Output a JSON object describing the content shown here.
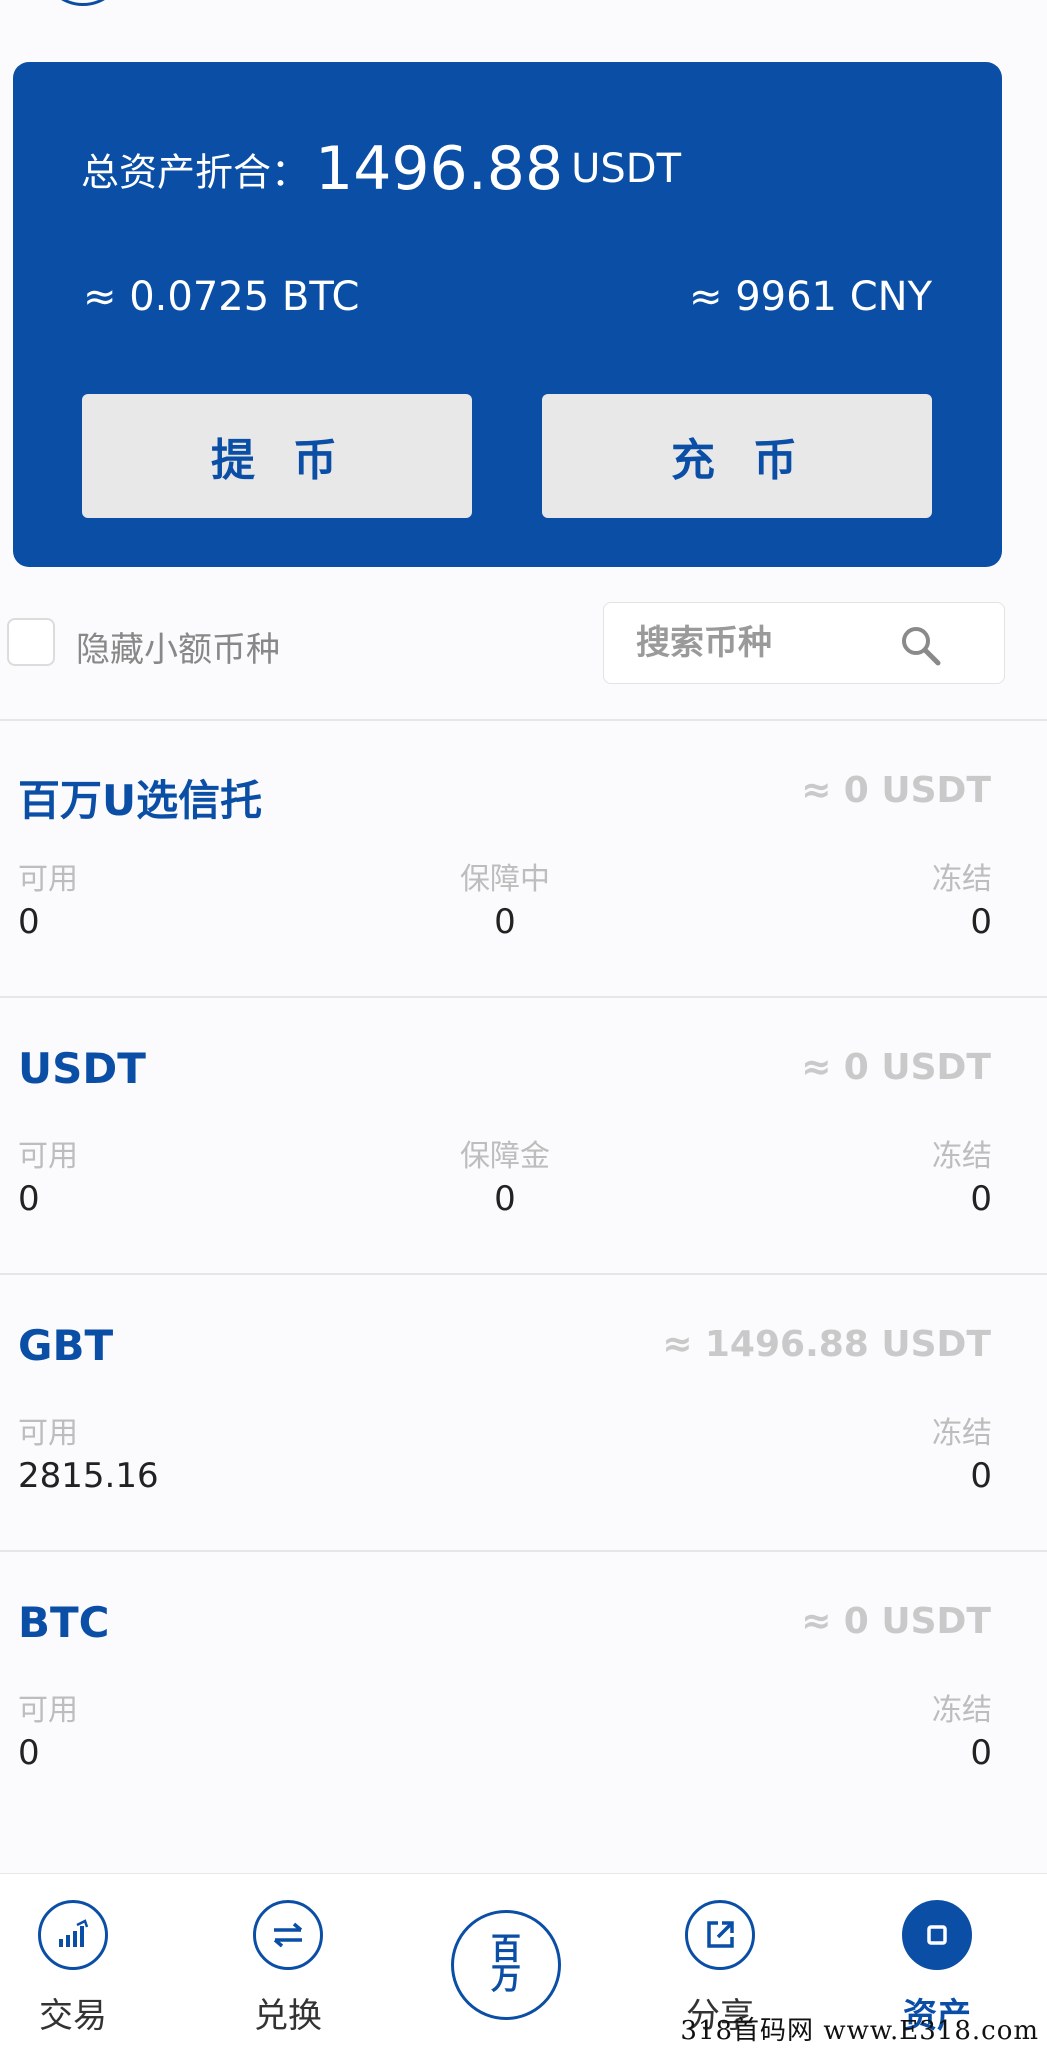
{
  "summary": {
    "total_label": "总资产折合：",
    "total_value": "1496.88",
    "total_unit": "USDT",
    "approx_btc": "≈ 0.0725 BTC",
    "approx_cny": "≈ 9961 CNY",
    "withdraw_label": "提币",
    "deposit_label": "充币"
  },
  "filter": {
    "hide_small_label": "隐藏小额币种",
    "search_placeholder": "搜索币种"
  },
  "coins": [
    {
      "name": "百万U选信托",
      "total": "≈ 0 USDT",
      "available_label": "可用",
      "available": "0",
      "mid_label": "保障中",
      "mid_value": "0",
      "frozen_label": "冻结",
      "frozen": "0"
    },
    {
      "name": "USDT",
      "total": "≈ 0 USDT",
      "available_label": "可用",
      "available": "0",
      "mid_label": "保障金",
      "mid_value": "0",
      "frozen_label": "冻结",
      "frozen": "0"
    },
    {
      "name": "GBT",
      "total": "≈ 1496.88 USDT",
      "available_label": "可用",
      "available": "2815.16",
      "frozen_label": "冻结",
      "frozen": "0"
    },
    {
      "name": "BTC",
      "total": "≈ 0 USDT",
      "available_label": "可用",
      "available": "0",
      "frozen_label": "冻结",
      "frozen": "0"
    }
  ],
  "nav": {
    "trade": "交易",
    "exchange": "兑换",
    "center_glyph_top": "百",
    "center_glyph_bottom": "万",
    "share": "分享",
    "assets": "资产"
  },
  "watermark": "318首码网 www.E318.com",
  "colors": {
    "brand": "#0a4ea6",
    "button_bg": "#e8e8e8",
    "muted": "#c9c9c9"
  }
}
